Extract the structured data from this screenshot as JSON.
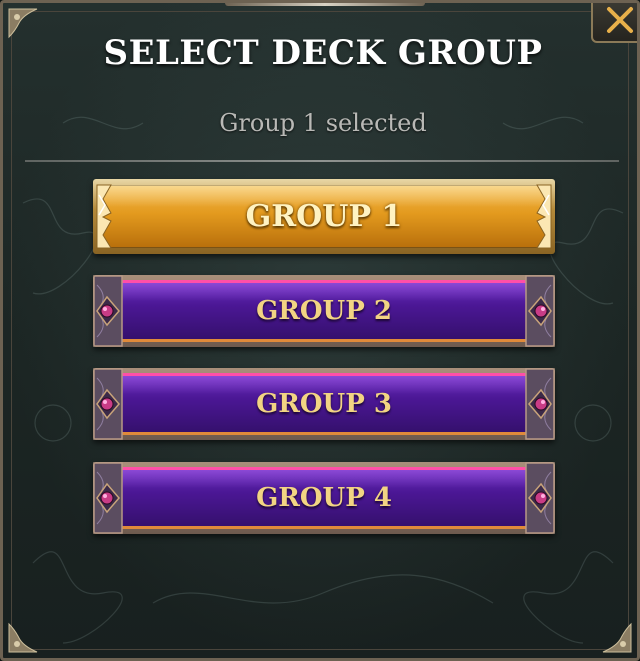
{
  "dialog": {
    "title": "SELECT DECK GROUP",
    "status": "Group 1 selected"
  },
  "groups": [
    {
      "label": "GROUP 1",
      "selected": true,
      "style": "gold"
    },
    {
      "label": "GROUP 2",
      "selected": false,
      "style": "purple"
    },
    {
      "label": "GROUP 3",
      "selected": false,
      "style": "purple"
    },
    {
      "label": "GROUP 4",
      "selected": false,
      "style": "purple"
    }
  ],
  "close_button": {
    "icon": "close-icon"
  },
  "colors": {
    "selected": "#e39a1e",
    "unselected": "#4b1795",
    "label_gold": "#f2d483",
    "title": "#ffffff"
  }
}
